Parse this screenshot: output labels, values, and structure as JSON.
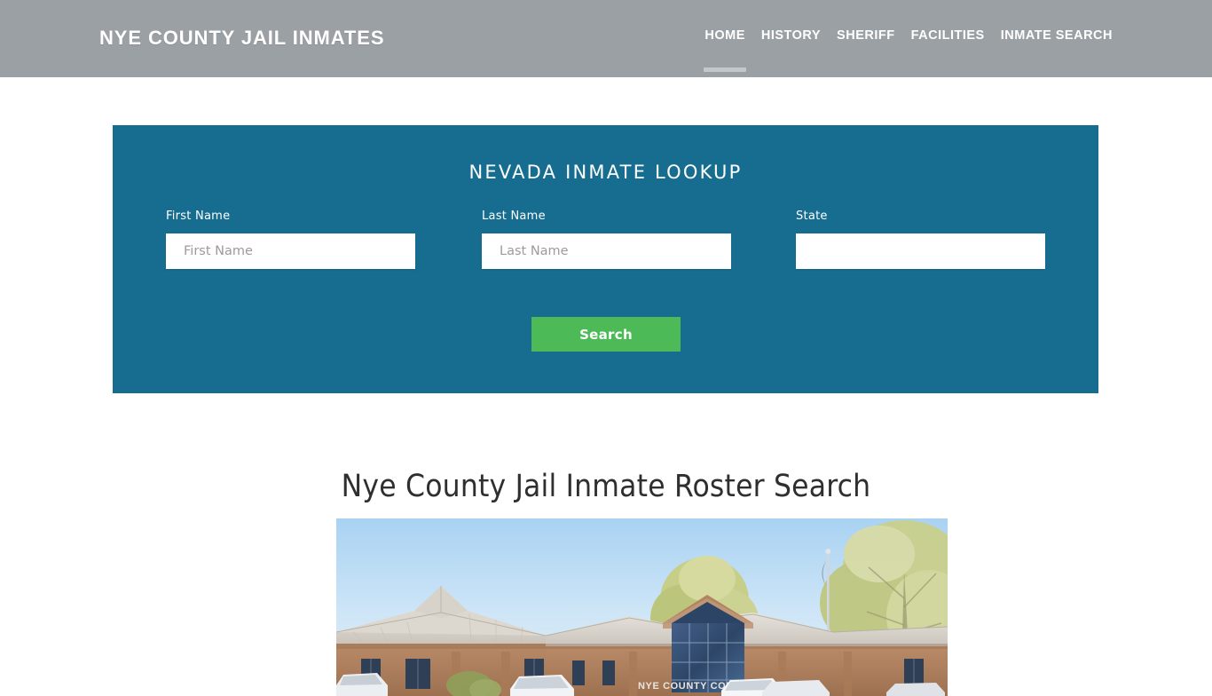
{
  "header": {
    "brand": "NYE COUNTY JAIL INMATES",
    "nav": [
      {
        "label": "HOME",
        "active": true
      },
      {
        "label": "HISTORY",
        "active": false
      },
      {
        "label": "SHERIFF",
        "active": false
      },
      {
        "label": "FACILITIES",
        "active": false
      },
      {
        "label": "INMATE SEARCH",
        "active": false
      }
    ],
    "bar_color": "#9ba0a4",
    "active_indicator_color": "#c4c8cb"
  },
  "lookup": {
    "title": "NEVADA INMATE LOOKUP",
    "panel_color": "#166d8f",
    "fields": {
      "first_name": {
        "label": "First Name",
        "placeholder": "First Name",
        "value": ""
      },
      "last_name": {
        "label": "Last Name",
        "placeholder": "Last Name",
        "value": ""
      },
      "state": {
        "label": "State",
        "placeholder": "",
        "value": ""
      }
    },
    "search_button": {
      "label": "Search",
      "color": "#4cbb57"
    }
  },
  "main": {
    "page_title": "Nye County Jail Inmate Roster Search",
    "photo": {
      "alt": "Nye County Courthouse building exterior with flagpole, trees and parked cars",
      "sign_text": "NYE COUNTY COURTHOUSE"
    }
  }
}
